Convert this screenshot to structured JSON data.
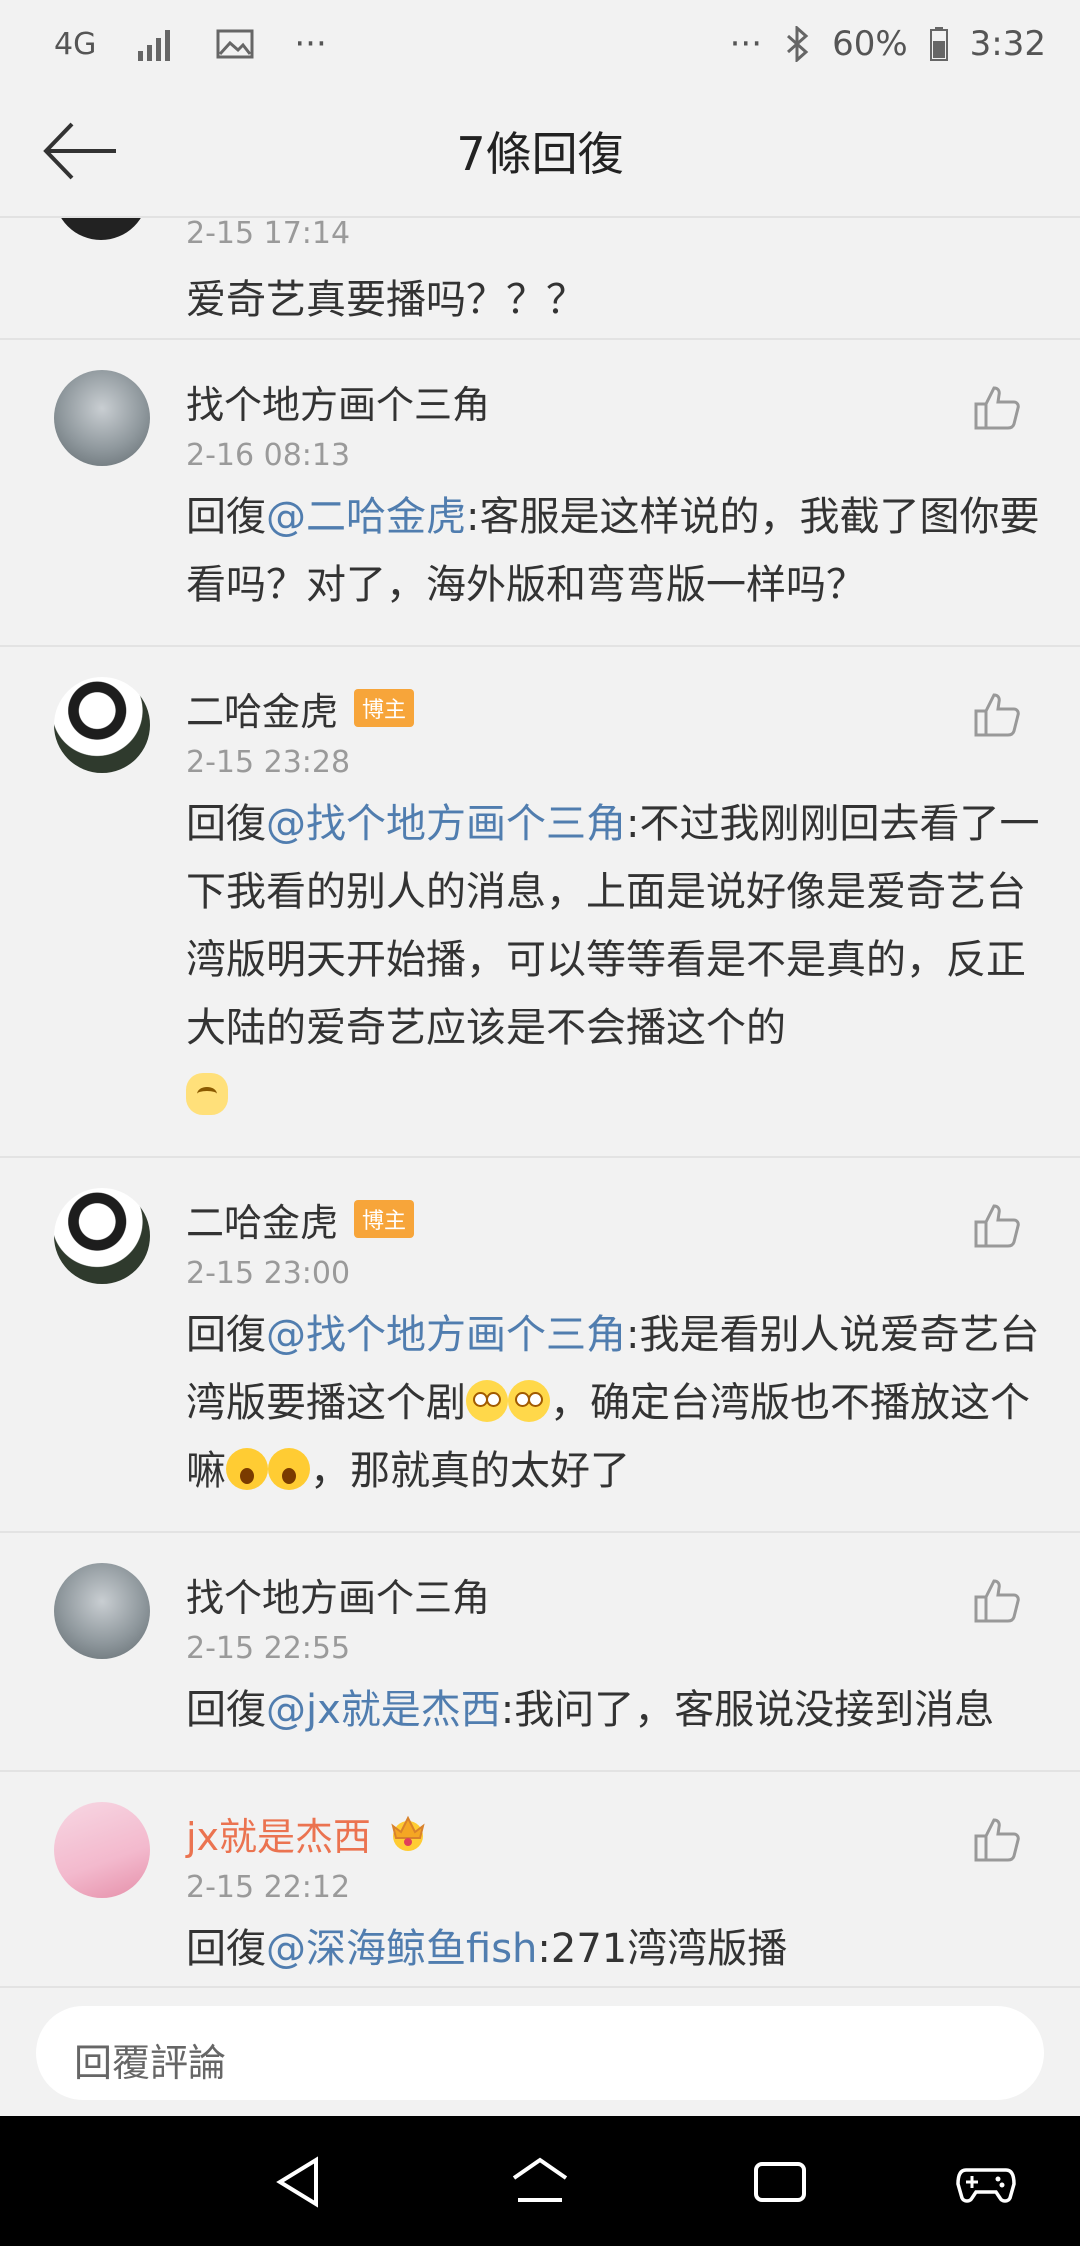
{
  "status_bar": {
    "network": "4G",
    "dots_left": "···",
    "dots_right": "···",
    "battery": "60%",
    "time": "3:32"
  },
  "header": {
    "title": "7條回復"
  },
  "top_partial": {
    "time": "2-15 17:14",
    "text": "爱奇艺真要播吗？？？"
  },
  "comments": [
    {
      "name": "找个地方画个三角",
      "time": "2-16 08:13",
      "prefix": "回復",
      "mention": "@二哈金虎",
      "text": ":客服是这样说的，我截了图你要看吗？对了，海外版和弯弯版一样吗？"
    },
    {
      "name": "二哈金虎",
      "badge": "博主",
      "time": "2-15 23:28",
      "prefix": "回復",
      "mention": "@找个地方画个三角",
      "text": ":不过我刚刚回去看了一下我看的别人的消息，上面是说好像是爱奇艺台湾版明天开始播，可以等等看是不是真的，反正大陆的爱奇艺应该是不会播这个的"
    },
    {
      "name": "二哈金虎",
      "badge": "博主",
      "time": "2-15 23:00",
      "prefix": "回復",
      "mention": "@找个地方画个三角",
      "text_a": ":我是看别人说爱奇艺台湾版要播这个剧",
      "text_b": "，确定台湾版也不播放这个嘛",
      "text_c": "，那就真的太好了"
    },
    {
      "name": "找个地方画个三角",
      "time": "2-15 22:55",
      "prefix": "回復",
      "mention": "@jx就是杰西",
      "text": ":我问了，客服说没接到消息"
    },
    {
      "name": "jx就是杰西",
      "time": "2-15 22:12",
      "prefix": "回復",
      "mention": "@深海鲸鱼fish",
      "text": ":271湾湾版播"
    }
  ],
  "reply_input": {
    "placeholder": "回覆評論"
  },
  "colors": {
    "mention": "#507daf",
    "vip_name": "#eb7350",
    "badge": "#f7a53a"
  }
}
